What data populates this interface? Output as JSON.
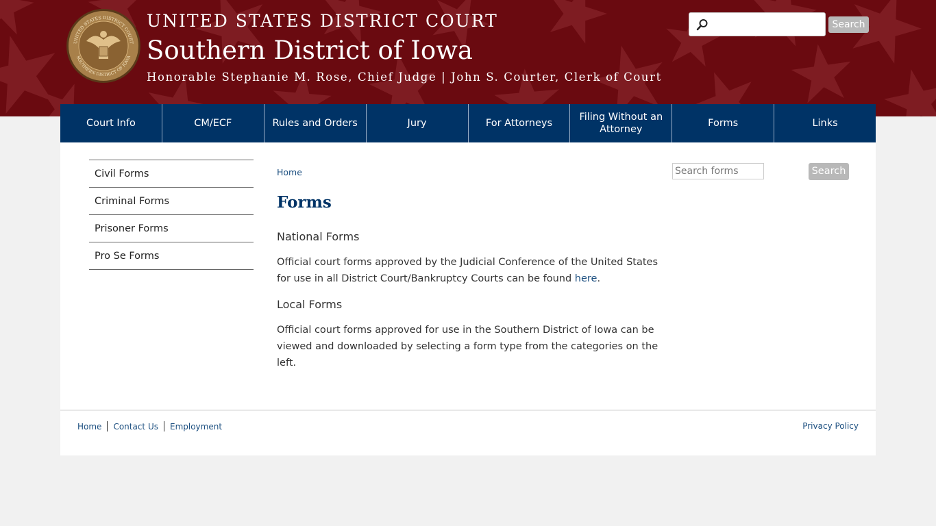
{
  "header": {
    "court_line": "UNITED STATES DISTRICT COURT",
    "district_line": "Southern District of Iowa",
    "judges_line": "Honorable Stephanie M. Rose, Chief Judge | John S. Courter, Clerk of Court",
    "seal_text_top": "UNITED STATES DISTRICT COURT",
    "seal_text_bottom": "SOUTHERN DISTRICT OF IOWA",
    "search": {
      "value": "",
      "button_label": "Search",
      "icon": "magnifier-icon"
    }
  },
  "nav": {
    "items": [
      {
        "label": "Court Info"
      },
      {
        "label": "CM/ECF"
      },
      {
        "label": "Rules and Orders"
      },
      {
        "label": "Jury"
      },
      {
        "label": "For Attorneys"
      },
      {
        "label": "Filing Without an Attorney"
      },
      {
        "label": "Forms"
      },
      {
        "label": "Links"
      }
    ]
  },
  "sidebar": {
    "items": [
      {
        "label": "Civil Forms"
      },
      {
        "label": "Criminal Forms"
      },
      {
        "label": "Prisoner Forms"
      },
      {
        "label": "Pro Se Forms"
      }
    ]
  },
  "main": {
    "breadcrumb": "Home",
    "title": "Forms",
    "national_heading": "National Forms",
    "national_text": "Official court forms approved by the Judicial Conference of the United States for use in all District Court/Bankruptcy Courts can be found ",
    "national_link": "here",
    "national_after": ".",
    "local_heading": "Local Forms",
    "local_text": "Official court forms approved for use in the Southern District of Iowa can be viewed and downloaded by selecting a form type from the categories on the left."
  },
  "forms_search": {
    "placeholder": "Search forms",
    "button_label": "Search"
  },
  "footer": {
    "links": [
      {
        "label": "Home"
      },
      {
        "label": "Contact Us"
      },
      {
        "label": "Employment"
      }
    ],
    "privacy": "Privacy Policy"
  },
  "colors": {
    "banner": "#6a0a10",
    "nav": "#003366",
    "link": "#1c4f80",
    "button_gray": "#b8b8b8"
  }
}
